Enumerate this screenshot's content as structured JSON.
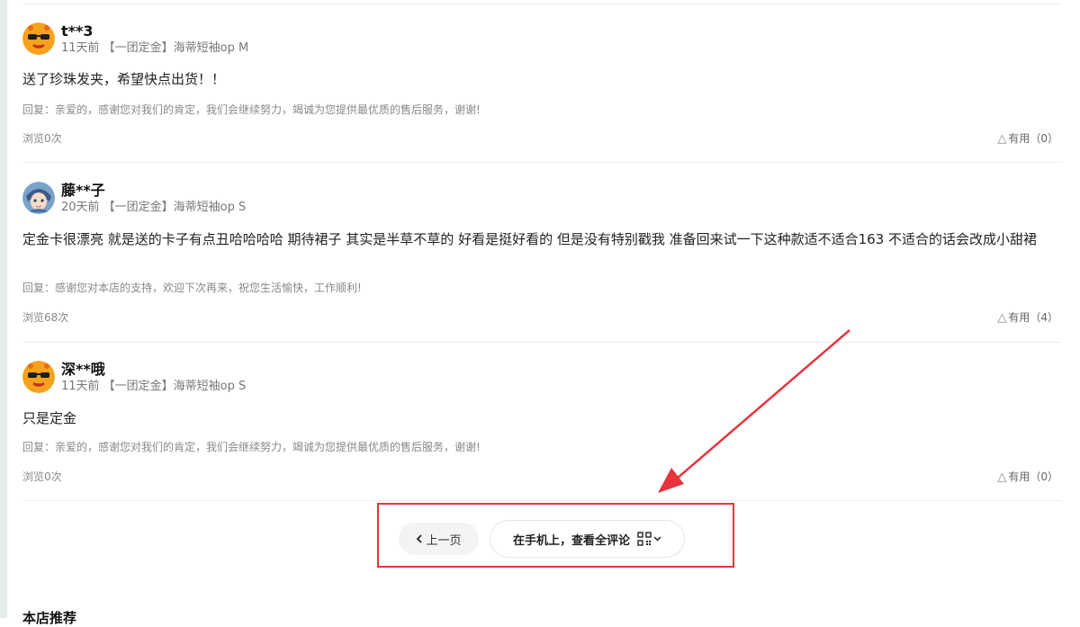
{
  "reviews": [
    {
      "username": "t**3",
      "meta": "11天前 【一团定金】海蒂短袖op M",
      "text": "送了珍珠发夹，希望快点出货！！",
      "reply": "回复：亲爱的，感谢您对我们的肯定，我们会继续努力，竭诚为您提供最优质的售后服务，谢谢!",
      "views": "浏览0次",
      "useful": "有用（0）",
      "avatar": "orange-sunglasses-avatar"
    },
    {
      "username": "藤**子",
      "meta": "20天前 【一团定金】海蒂短袖op S",
      "text": "定金卡很漂亮 就是送的卡子有点丑哈哈哈哈 期待裙子 其实是半草不草的 好看是挺好看的 但是没有特别戳我 准备回来试一下这种款适不适合163 不适合的话会改成小甜裙",
      "reply": "回复：感谢您对本店的支持，欢迎下次再来，祝您生活愉快，工作顺利!",
      "views": "浏览68次",
      "useful": "有用（4）",
      "avatar": "anime-character-avatar"
    },
    {
      "username": "深**哦",
      "meta": "11天前 【一团定金】海蒂短袖op S",
      "text": "只是定金",
      "reply": "回复：亲爱的，感谢您对我们的肯定，我们会继续努力，竭诚为您提供最优质的售后服务，谢谢!",
      "views": "浏览0次",
      "useful": "有用（0）",
      "avatar": "orange-sunglasses-avatar"
    }
  ],
  "pagination": {
    "prev_label": "上一页",
    "mobile_label": "在手机上，查看全评论"
  },
  "section": {
    "title": "本店推荐"
  },
  "annotation": {
    "color": "#e8343c"
  }
}
